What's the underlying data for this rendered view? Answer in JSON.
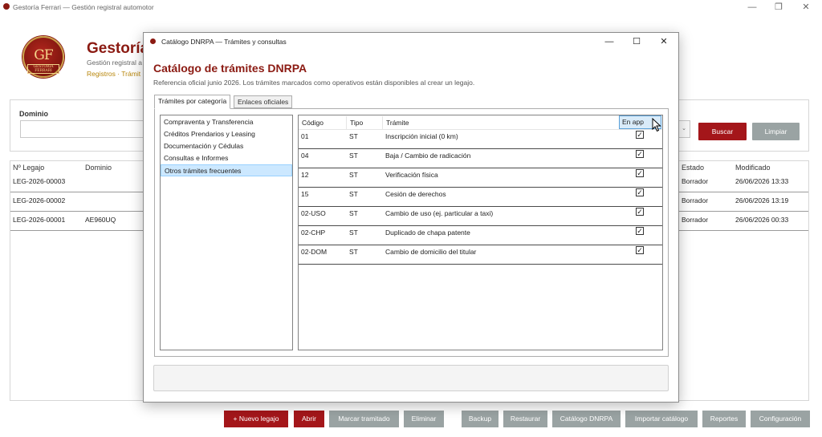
{
  "window": {
    "title": "Gestoría Ferrari — Gestión registral automotor",
    "minimize": "—",
    "maximize": "❐",
    "close": "✕"
  },
  "header": {
    "logo_monogram": "GF",
    "logo_text": "GESTORIA FERRARI",
    "title": "Gestoría",
    "subtitle": "Gestión registral a",
    "breadcrumb": "Registros · Trámit"
  },
  "search": {
    "dominio_label": "Dominio",
    "dominio_value": "",
    "dropdown_icon": "chevron-down-icon",
    "buscar_label": "Buscar",
    "limpiar_label": "Limpiar"
  },
  "legajos": {
    "columns": [
      "Nº Legajo",
      "Dominio",
      "Estado",
      "Modificado"
    ],
    "rows": [
      {
        "legajo": "LEG-2026-00003",
        "dominio": "",
        "estado": "Borrador",
        "modificado": "26/06/2026 13:33"
      },
      {
        "legajo": "LEG-2026-00002",
        "dominio": "",
        "estado": "Borrador",
        "modificado": "26/06/2026 13:19"
      },
      {
        "legajo": "LEG-2026-00001",
        "dominio": "AE960UQ",
        "estado": "Borrador",
        "modificado": "26/06/2026 00:33"
      }
    ]
  },
  "toolbar": {
    "nuevo": "+ Nuevo legajo",
    "abrir": "Abrir",
    "marcar": "Marcar tramitado",
    "eliminar": "Eliminar",
    "backup": "Backup",
    "restaurar": "Restaurar",
    "catalogo": "Catálogo DNRPA",
    "importar": "Importar catálogo",
    "reportes": "Reportes",
    "configuracion": "Configuración"
  },
  "modal": {
    "window_title": "Catálogo DNRPA — Trámites y consultas",
    "minimize": "—",
    "maximize": "☐",
    "close": "✕",
    "heading": "Catálogo de trámites DNRPA",
    "reference": "Referencia oficial junio 2026. Los trámites marcados como operativos están disponibles al crear un legajo.",
    "tabs": [
      "Trámites por categoría",
      "Enlaces oficiales"
    ],
    "categories": [
      "Compraventa y Transferencia",
      "Créditos Prendarios y Leasing",
      "Documentación y Cédulas",
      "Consultas e Informes",
      "Otros trámites frecuentes"
    ],
    "selected_category": 4,
    "columns": [
      "Código",
      "Tipo",
      "Trámite",
      "En app"
    ],
    "tramites": [
      {
        "codigo": "01",
        "tipo": "ST",
        "tramite": "Inscripción inicial (0 km)",
        "en_app": true
      },
      {
        "codigo": "04",
        "tipo": "ST",
        "tramite": "Baja / Cambio de radicación",
        "en_app": true
      },
      {
        "codigo": "12",
        "tipo": "ST",
        "tramite": "Verificación física",
        "en_app": true
      },
      {
        "codigo": "15",
        "tipo": "ST",
        "tramite": "Cesión de derechos",
        "en_app": true
      },
      {
        "codigo": "02-USO",
        "tipo": "ST",
        "tramite": "Cambio de uso (ej. particular a taxi)",
        "en_app": true
      },
      {
        "codigo": "02-CHP",
        "tipo": "ST",
        "tramite": "Duplicado de chapa patente",
        "en_app": true
      },
      {
        "codigo": "02-DOM",
        "tipo": "ST",
        "tramite": "Cambio de domicilio del titular",
        "en_app": true
      }
    ],
    "check_glyph": "✓",
    "status_text": ""
  },
  "colors": {
    "brand": "#8b1a12",
    "accent_gold": "#b8860b",
    "button_red": "#a4161a",
    "button_gray": "#9aa3a3",
    "selection": "#cce8ff"
  }
}
